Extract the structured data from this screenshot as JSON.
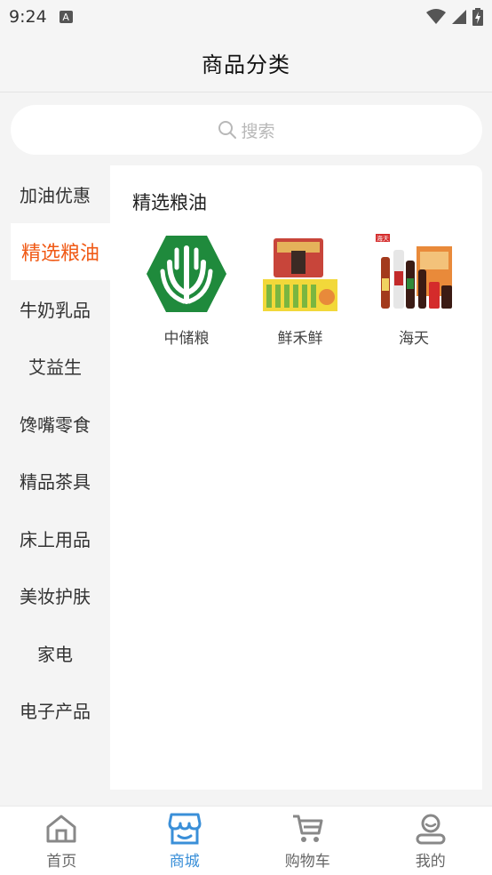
{
  "status_bar": {
    "time": "9:24",
    "badge": "A"
  },
  "header": {
    "title": "商品分类"
  },
  "search": {
    "placeholder": "搜索"
  },
  "sidebar": {
    "items": [
      {
        "label": "加油优惠"
      },
      {
        "label": "精选粮油",
        "active": true
      },
      {
        "label": "牛奶乳品"
      },
      {
        "label": "艾益生"
      },
      {
        "label": "馋嘴零食"
      },
      {
        "label": "精品茶具"
      },
      {
        "label": "床上用品"
      },
      {
        "label": "美妆护肤"
      },
      {
        "label": "家电"
      },
      {
        "label": "电子产品"
      }
    ]
  },
  "content": {
    "section_title": "精选粮油",
    "brands": [
      {
        "name": "中储粮",
        "icon": "zhongchuliang-logo"
      },
      {
        "name": "鲜禾鲜",
        "icon": "xianhexian-product-image"
      },
      {
        "name": "海天",
        "icon": "haitian-product-image",
        "logo_text": "海天"
      }
    ]
  },
  "bottom_nav": {
    "items": [
      {
        "label": "首页",
        "icon": "home-icon"
      },
      {
        "label": "商城",
        "icon": "store-icon",
        "active": true
      },
      {
        "label": "购物车",
        "icon": "cart-icon"
      },
      {
        "label": "我的",
        "icon": "profile-icon"
      }
    ]
  },
  "colors": {
    "accent": "#f05a16",
    "nav_active": "#3a8fd8",
    "brand_green": "#1f8a3c"
  }
}
